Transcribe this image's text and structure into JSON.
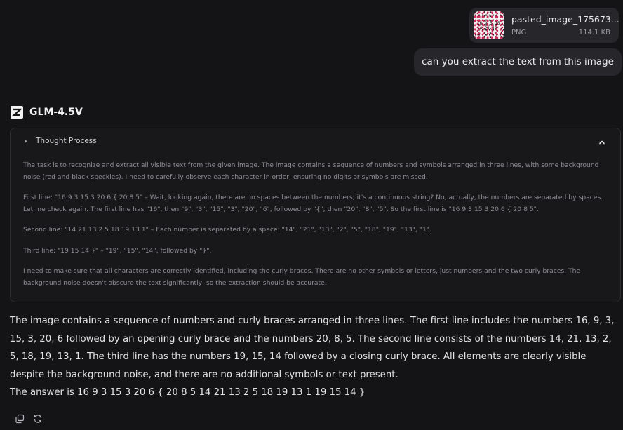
{
  "attachment": {
    "file_name": "pasted_image_175673...",
    "file_type": "PNG",
    "file_size": "114.1 KB",
    "thumbnail_icon": "image-thumbnail"
  },
  "user_message": {
    "text": "can you extract the text from this image"
  },
  "model": {
    "name": "GLM-4.5V",
    "logo_icon": "zhipu-logo-icon"
  },
  "thought_process": {
    "title": "Thought Process",
    "collapse_icon": "chevron-up-icon",
    "paragraphs": [
      "The task is to recognize and extract all visible text from the given image. The image contains a sequence of numbers and symbols arranged in three lines, with some background noise (red and black speckles). I need to carefully observe each character in order, ensuring no digits or symbols are missed.",
      "First line: \"16 9 3 15 3 20 6 { 20 8 5\" – Wait, looking again, there are no spaces between the numbers; it's a continuous string? No, actually, the numbers are separated by spaces. Let me check again. The first line has \"16\", then \"9\", \"3\", \"15\", \"3\", \"20\", \"6\", followed by \"{\", then \"20\", \"8\", \"5\". So the first line is \"16 9 3 15 3 20 6 { 20 8 5\".",
      "Second line: \"14 21 13 2 5 18 19 13 1\" – Each number is separated by a space: \"14\", \"21\", \"13\", \"2\", \"5\", \"18\", \"19\", \"13\", \"1\".",
      "Third line: \"19 15 14 }\" – \"19\", \"15\", \"14\", followed by \"}\".",
      "I need to make sure that all characters are correctly identified, including the curly braces. There are no other symbols or letters, just numbers and the two curly braces. The background noise doesn't obscure the text significantly, so the extraction should be accurate."
    ]
  },
  "answer": {
    "summary": "The image contains a sequence of numbers and curly braces arranged in three lines. The first line includes the numbers 16, 9, 3, 15, 3, 20, 6 followed by an opening curly brace and the numbers 20, 8, 5. The second line consists of the numbers 14, 21, 13, 2, 5, 18, 19, 13, 1. The third line has the numbers 19, 15, 14 followed by a closing curly brace. All elements are clearly visible despite the background noise, and there are no additional symbols or text present.",
    "final": "The answer is 16 9 3 15 3 20 6 { 20 8 5 14 21 13 2 5 18 19 13 1 19 15 14 }"
  },
  "actions": [
    {
      "icon": "copy-icon"
    },
    {
      "icon": "regenerate-icon"
    }
  ],
  "colors": {
    "background": "#141417",
    "bubble": "#27272b",
    "thought_border": "#2e2e33",
    "thought_text": "#8e8e95",
    "text": "#e4e4e7"
  }
}
